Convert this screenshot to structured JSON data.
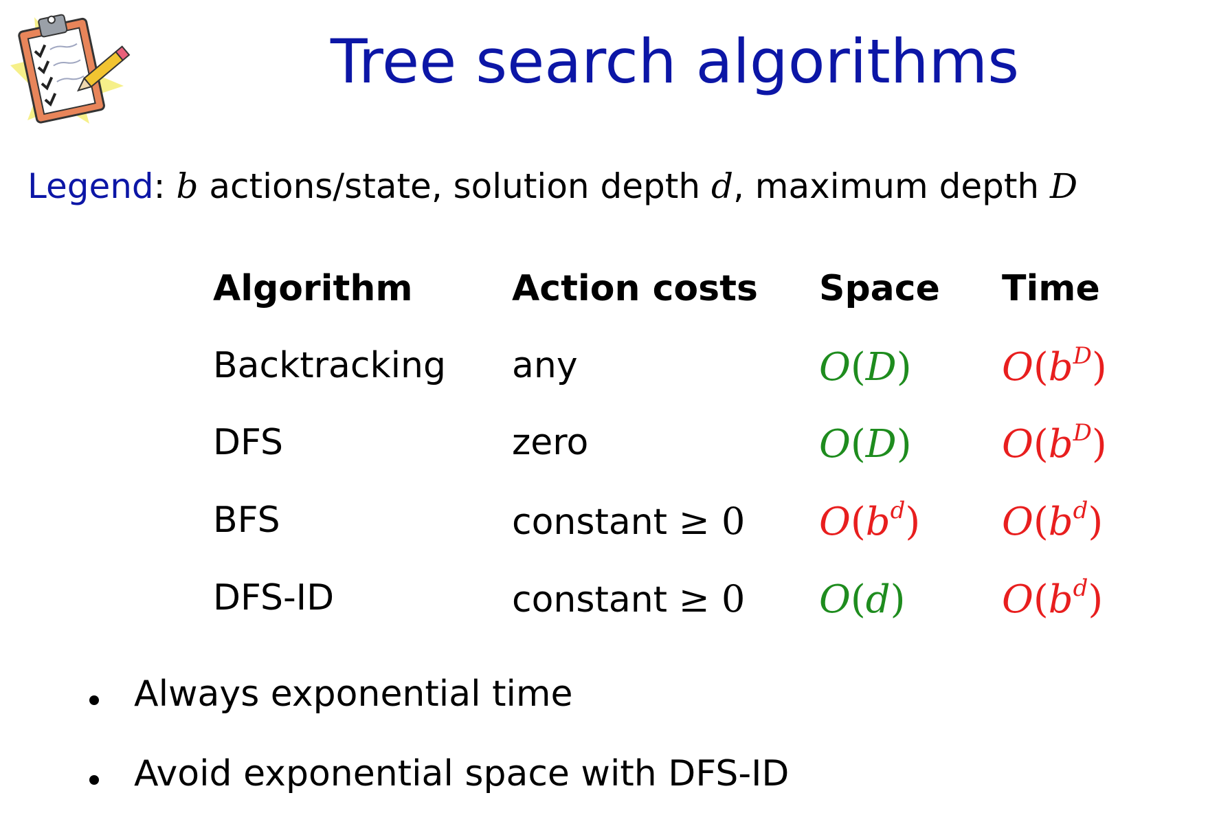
{
  "title": "Tree search algorithms",
  "legend": {
    "label": "Legend",
    "colon": ":",
    "b": "b",
    "text1": "actions/state, solution depth",
    "d": "d",
    "text2": ", maximum depth",
    "D": "D"
  },
  "table": {
    "headers": [
      "Algorithm",
      "Action costs",
      "Space",
      "Time"
    ],
    "rows": [
      {
        "algorithm": "Backtracking",
        "costs": "any",
        "costs_math": "",
        "space_sup": "",
        "space_arg": "D",
        "space_color": "green",
        "time_sup": "D",
        "time_color": "red"
      },
      {
        "algorithm": "DFS",
        "costs": "zero",
        "costs_math": "",
        "space_sup": "",
        "space_arg": "D",
        "space_color": "green",
        "time_sup": "D",
        "time_color": "red"
      },
      {
        "algorithm": "BFS",
        "costs": "constant",
        "costs_math": "≥ 0",
        "space_sup": "d",
        "space_arg": "b",
        "space_color": "red",
        "time_sup": "d",
        "time_color": "red"
      },
      {
        "algorithm": "DFS-ID",
        "costs": "constant",
        "costs_math": "≥ 0",
        "space_sup": "",
        "space_arg": "d",
        "space_color": "green",
        "time_sup": "d",
        "time_color": "red"
      }
    ]
  },
  "bullets": [
    "Always exponential time",
    "Avoid exponential space with DFS-ID"
  ],
  "colors": {
    "title": "#0c16a6",
    "green": "#1e8c1e",
    "red": "#e81e1e"
  },
  "icons": {
    "clip": "clipboard-checklist-icon"
  }
}
